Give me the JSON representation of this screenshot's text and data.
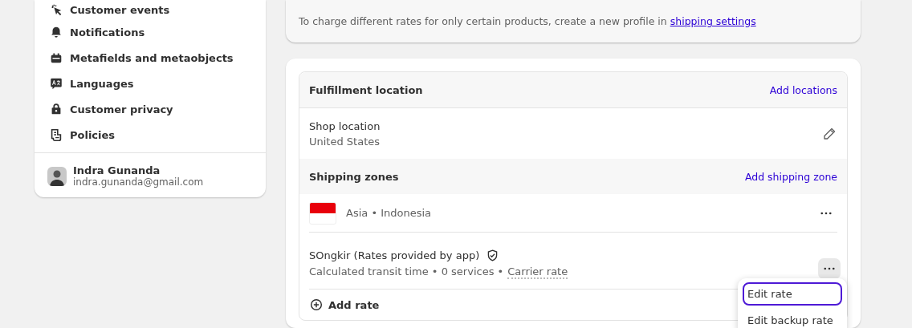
{
  "sidebar": {
    "items": [
      {
        "label": "Customer events"
      },
      {
        "label": "Notifications"
      },
      {
        "label": "Metafields and metaobjects"
      },
      {
        "label": "Languages"
      },
      {
        "label": "Customer privacy"
      },
      {
        "label": "Policies"
      }
    ],
    "user": {
      "name": "Indra Gunanda",
      "email": "indra.gunanda@gmail.com"
    }
  },
  "notice": {
    "text": "To charge different rates for only certain products, create a new profile in",
    "link": "shipping settings"
  },
  "fulfillment": {
    "title": "Fulfillment location",
    "action": "Add locations",
    "location": {
      "name": "Shop location",
      "country": "United States"
    }
  },
  "zones": {
    "title": "Shipping zones",
    "action": "Add shipping zone",
    "zone": {
      "name": "Asia • Indonesia"
    },
    "rate": {
      "name": "SOngkir (Rates provided by app)",
      "details": "Calculated transit time • 0 services •",
      "carrier": "Carrier rate"
    },
    "add_rate": "Add rate"
  },
  "menu": {
    "items": [
      {
        "label": "Edit rate",
        "selected": true
      },
      {
        "label": "Edit backup rate",
        "selected": false
      }
    ]
  }
}
